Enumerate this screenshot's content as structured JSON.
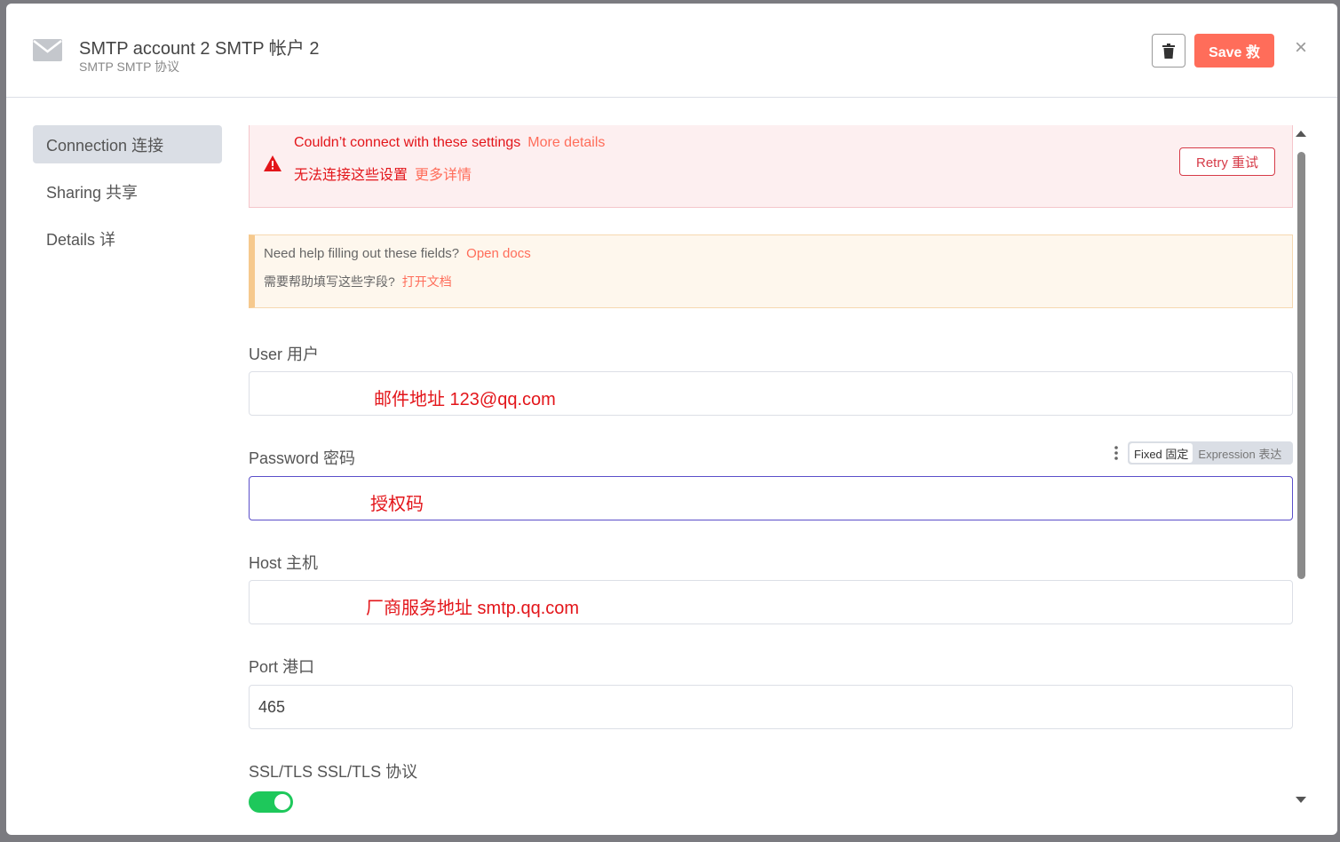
{
  "header": {
    "title": "SMTP account 2  SMTP 帐户 2",
    "subtitle": "SMTP  SMTP 协议",
    "save_label": "Save  救",
    "close_label": "×"
  },
  "sidebar": {
    "items": [
      {
        "label": "Connection  连接"
      },
      {
        "label": "Sharing  共享"
      },
      {
        "label": "Details  详"
      }
    ]
  },
  "error_alert": {
    "line1": "Couldn’t connect with these settings",
    "line1_link": "More details",
    "line2": "无法连接这些设置",
    "line2_link": "更多详情",
    "retry_label": "Retry  重试"
  },
  "help_alert": {
    "line1": "Need help filling out these fields?",
    "line1_link": "Open docs",
    "line2": "需要帮助填写这些字段?",
    "line2_link": "打开文档"
  },
  "fields": {
    "user": {
      "label": "User   用户",
      "annotation": "邮件地址 123@qq.com"
    },
    "password": {
      "label": "Password   密码",
      "annotation": "授权码",
      "mode_fixed": "Fixed  固定",
      "mode_expression": "Expression  表达"
    },
    "host": {
      "label": "Host   主机",
      "annotation": "厂商服务地址  smtp.qq.com"
    },
    "port": {
      "label": "Port   港口",
      "value": "465"
    },
    "ssl": {
      "label": "SSL/TLS   SSL/TLS 协议",
      "enabled": true
    }
  },
  "colors": {
    "accent": "#ff6d5a",
    "error": "#e3151a",
    "toggle_on": "#1ec85b"
  }
}
